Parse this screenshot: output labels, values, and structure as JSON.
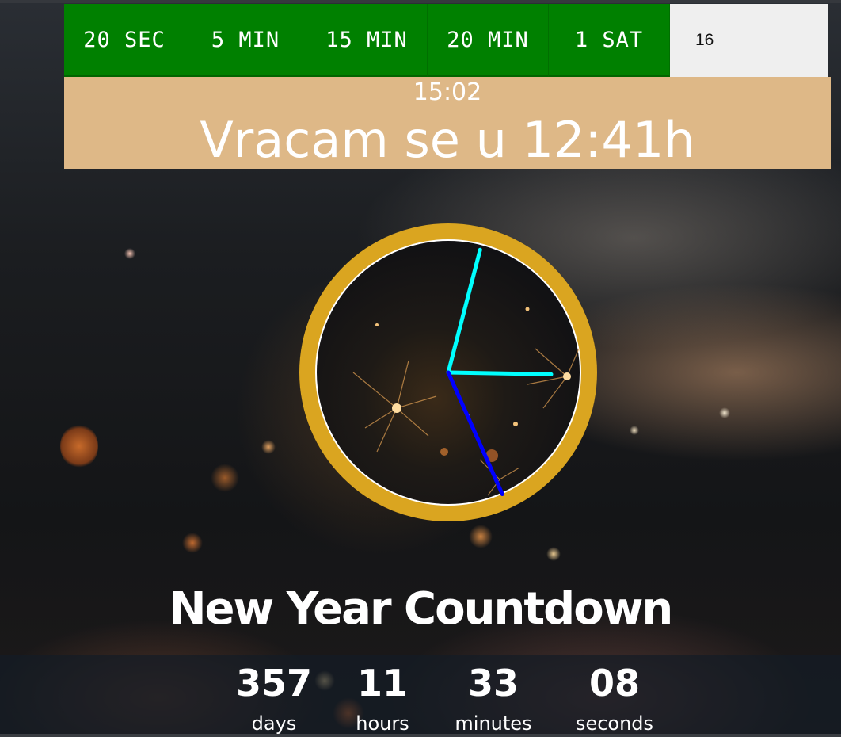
{
  "timer_buttons": [
    "20 SEC",
    "5 MIN",
    "15 MIN",
    "20 MIN",
    "1 SAT"
  ],
  "custom_input": {
    "value": "16",
    "placeholder": ""
  },
  "status": {
    "current_time": "15:02",
    "return_message": "Vracam se u 12:41h"
  },
  "clock": {
    "hours": 15,
    "minutes": 2,
    "seconds": 26,
    "rim_color": "#daa520",
    "hour_hand_color": "#00ffff",
    "minute_hand_color": "#00ffff",
    "second_hand_color": "#0000ff"
  },
  "countdown": {
    "title": "New Year Countdown",
    "days": "357",
    "hours": "11",
    "minutes": "33",
    "seconds": "08",
    "days_label": "days",
    "hours_label": "hours",
    "minutes_label": "minutes",
    "seconds_label": "seconds"
  },
  "colors": {
    "button_green": "#008000",
    "status_panel": "#deb887"
  }
}
